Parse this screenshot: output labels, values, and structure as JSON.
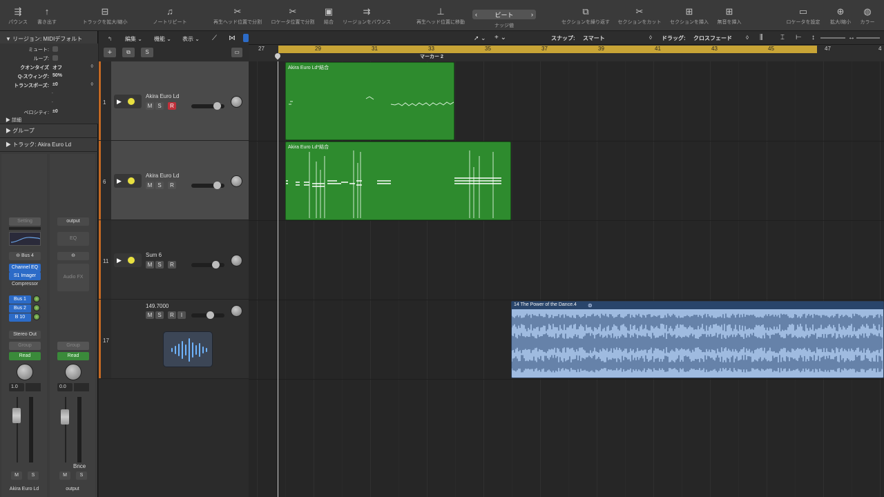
{
  "toolbar": {
    "buttons": [
      {
        "label": "パウンス",
        "icon": "bounce-icon",
        "glyph": "⇶"
      },
      {
        "label": "書き出す",
        "icon": "export-icon",
        "glyph": "↑"
      },
      {
        "label": "トラックを拡大/縮小",
        "icon": "zoom-track-icon",
        "glyph": "⊟"
      },
      {
        "label": "ノートリピート",
        "icon": "note-repeat-icon",
        "glyph": "♫"
      },
      {
        "label": "再生ヘッド位置で分割",
        "icon": "split-playhead-icon",
        "glyph": "✂"
      },
      {
        "label": "ロケータ位置で分割",
        "icon": "split-locators-icon",
        "glyph": "✂"
      },
      {
        "label": "結合",
        "icon": "join-icon",
        "glyph": "▣"
      },
      {
        "label": "リージョンをバウンス",
        "icon": "bounce-region-icon",
        "glyph": "⇉"
      },
      {
        "label": "再生ヘッド位置に移動",
        "icon": "move-playhead-icon",
        "glyph": "⊥"
      },
      {
        "label": "ナッジ値",
        "icon": "nudge-icon",
        "glyph": ""
      },
      {
        "label": "セクションを繰り返す",
        "icon": "repeat-section-icon",
        "glyph": "⧉"
      },
      {
        "label": "セクションをカット",
        "icon": "cut-section-icon",
        "glyph": "✂"
      },
      {
        "label": "セクションを挿入",
        "icon": "insert-section-icon",
        "glyph": "⊞"
      },
      {
        "label": "無音を挿入",
        "icon": "insert-silence-icon",
        "glyph": "⊞"
      },
      {
        "label": "ロケータを設定",
        "icon": "set-locators-icon",
        "glyph": "▭"
      },
      {
        "label": "拡大/縮小",
        "icon": "zoom-icon",
        "glyph": "⊕"
      },
      {
        "label": "カラー",
        "icon": "color-icon",
        "glyph": "◍"
      }
    ],
    "nudge_value": "ビート",
    "nudge_prev": "‹",
    "nudge_next": "›"
  },
  "inspector": {
    "region_header": "▼ リージョン: MIDIデフォルト",
    "rows": [
      {
        "label": "ミュート:",
        "value": ""
      },
      {
        "label": "ループ:",
        "value": ""
      },
      {
        "label": "クオンタイズ",
        "value": "オフ"
      },
      {
        "label": "Q-スウィング:",
        "value": "50%"
      },
      {
        "label": "トランスポーズ:",
        "value": "±0"
      },
      {
        "label": "-",
        "value": ""
      },
      {
        "label": "-",
        "value": ""
      },
      {
        "label": "ベロシティ:",
        "value": "±0"
      }
    ],
    "details_label": "▶ 詳細",
    "group_label": "▶ グループ",
    "track_label": "▶ トラック: Akira Euro Ld",
    "strip1": {
      "setting": "Setting",
      "bus": "Bus 4",
      "plugins": [
        "Channel EQ",
        "S1 Imager",
        "Compressor"
      ],
      "sends": [
        "Bus 1",
        "Bus 2",
        "B 10"
      ],
      "output": "Stereo Out",
      "group": "Group",
      "automation": "Read",
      "pan_value": "1.0",
      "name": "Akira Euro Ld",
      "mute": "M",
      "solo": "S"
    },
    "strip2": {
      "setting": "output",
      "eq": "EQ",
      "audio_fx": "Audio FX",
      "group": "Group",
      "automation": "Read",
      "pan_value": "0.0",
      "bounce": "Bnce",
      "name": "output",
      "mute": "M",
      "solo": "S"
    }
  },
  "tracks_header": {
    "add": "+",
    "duplicate": "⧉",
    "solo": "S",
    "global": "▭"
  },
  "tracks": [
    {
      "number": "1",
      "name": "Akira Euro Ld",
      "record": "R",
      "record_armed": true
    },
    {
      "number": "6",
      "name": "Akira Euro Ld",
      "record": "R",
      "record_armed": false
    },
    {
      "number": "11",
      "name": "Sum 6",
      "record": "R",
      "record_armed": false
    },
    {
      "number": "17",
      "name": "149.7000",
      "record": "R",
      "record_armed": false,
      "input": "I",
      "is_audio": true
    }
  ],
  "arrange_menu": {
    "back": "↰",
    "edit": "編集",
    "functions": "機能",
    "view": "表示",
    "snap_label": "スナップ:",
    "snap_value": "スマート",
    "drag_label": "ドラッグ:",
    "drag_value": "クロスフェード"
  },
  "ruler": {
    "bars": [
      "27",
      "29",
      "31",
      "33",
      "35",
      "37",
      "39",
      "41",
      "43",
      "45",
      "47",
      "4"
    ],
    "marker": "マーカー 2"
  },
  "regions": [
    {
      "name": "Akira Euro Ld*結合",
      "type": "midi",
      "track": 0
    },
    {
      "name": "Akira Euro Ld*結合",
      "type": "midi",
      "track": 1
    },
    {
      "name": "14 The Power of the Dance.4",
      "type": "audio",
      "track": 3
    }
  ],
  "colors": {
    "midi_region": "#2e8b2e",
    "audio_region": "#9fbbe0",
    "ruler_cycle": "#c8a436",
    "accent_blue": "#2c6bc7"
  }
}
